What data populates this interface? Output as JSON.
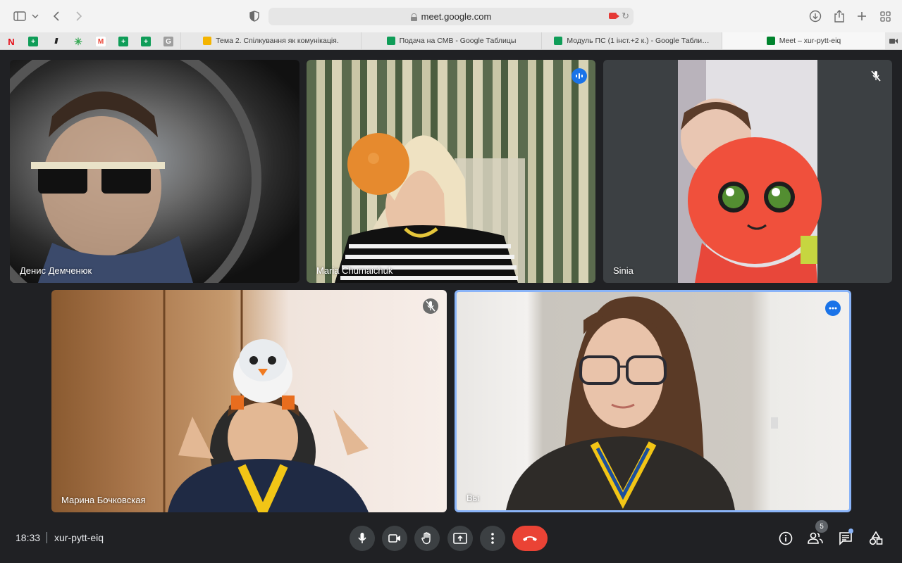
{
  "browser": {
    "url": "meet.google.com",
    "tabs": [
      {
        "label": "Тема 2. Спілкування як комунікація.",
        "favicon_color": "#f4b400"
      },
      {
        "label": "Подача на СМВ - Google Таблицы",
        "favicon_color": "#0f9d58"
      },
      {
        "label": "Модуль ПС (1 інст.+2 к.) - Google Табли…",
        "favicon_color": "#0f9d58"
      },
      {
        "label": "Meet – xur-pytt-eiq",
        "favicon_color": "#00832d"
      }
    ],
    "bookmark_icons": [
      "netflix-icon",
      "sheets-icon",
      "stripes-icon",
      "asterisk-icon",
      "gmail-icon",
      "sheets-icon",
      "sheets-icon",
      "g-icon"
    ]
  },
  "participants": [
    {
      "name": "Денис Демченюк",
      "status_icon": "none"
    },
    {
      "name": "Maria Chumaichuk",
      "status_icon": "speaking-icon"
    },
    {
      "name": "Sinia",
      "status_icon": "mic-off-icon"
    },
    {
      "name": "Марина Бочковская",
      "status_icon": "mic-off-icon"
    },
    {
      "name": "Вы",
      "status_icon": "more-options-icon"
    }
  ],
  "meeting": {
    "time": "18:33",
    "code": "xur-pytt-eiq",
    "participant_count": "5"
  },
  "colors": {
    "accent": "#1a73e8",
    "end_call": "#ea4335",
    "background": "#202124"
  }
}
